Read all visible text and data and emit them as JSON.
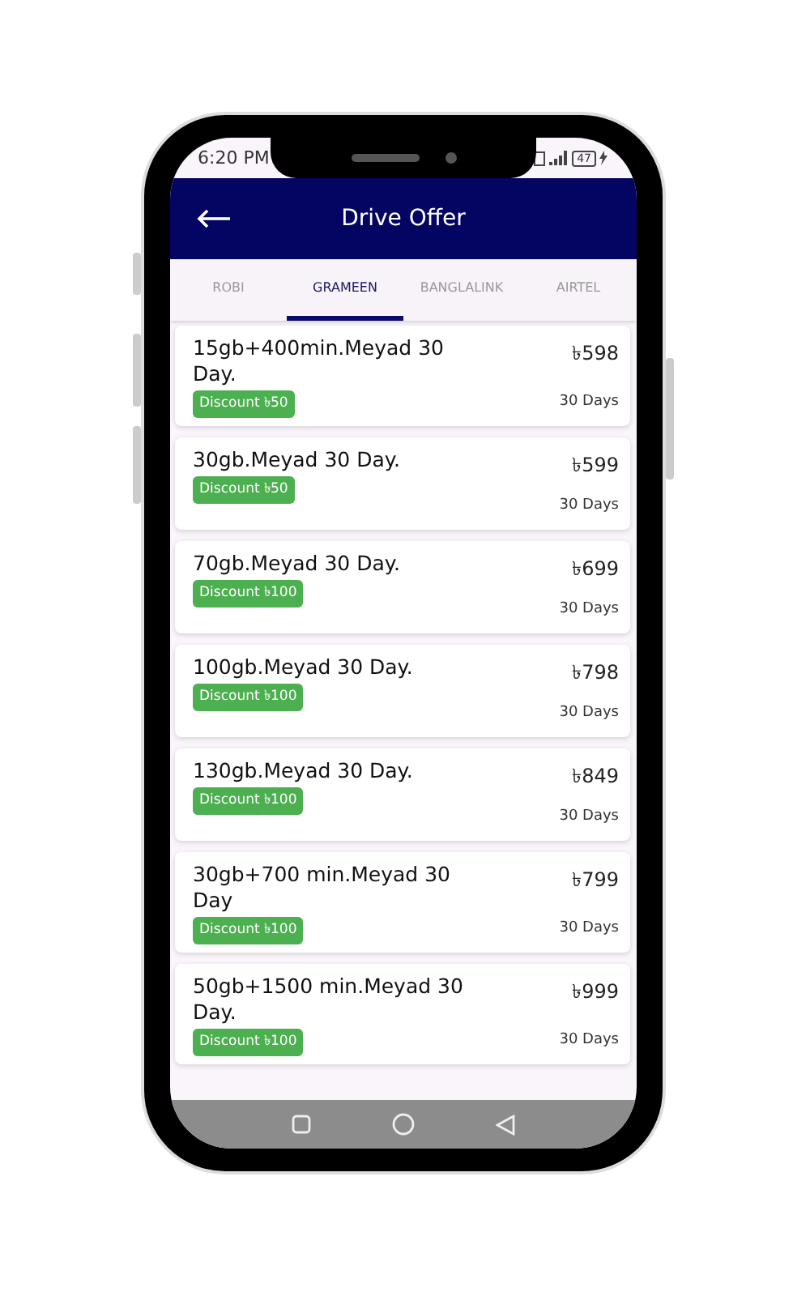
{
  "status_bar": {
    "time": "6:20 PM",
    "battery": "47"
  },
  "header": {
    "title": "Drive Offer"
  },
  "tabs": [
    {
      "label": "ROBI",
      "selected": false
    },
    {
      "label": "GRAMEEN",
      "selected": true
    },
    {
      "label": "BANGLALINK",
      "selected": false
    },
    {
      "label": "AIRTEL",
      "selected": false
    }
  ],
  "offers": [
    {
      "name": "15gb+400min.Meyad 30 Day.",
      "discount": "Discount ৳50",
      "price": "৳598",
      "validity": "30 Days"
    },
    {
      "name": "30gb.Meyad 30 Day.",
      "discount": "Discount ৳50",
      "price": "৳599",
      "validity": "30 Days"
    },
    {
      "name": "70gb.Meyad 30 Day.",
      "discount": "Discount ৳100",
      "price": "৳699",
      "validity": "30 Days"
    },
    {
      "name": "100gb.Meyad 30 Day.",
      "discount": "Discount ৳100",
      "price": "৳798",
      "validity": "30 Days"
    },
    {
      "name": "130gb.Meyad 30 Day.",
      "discount": "Discount ৳100",
      "price": "৳849",
      "validity": "30 Days"
    },
    {
      "name": "30gb+700 min.Meyad 30 Day",
      "discount": "Discount ৳100",
      "price": "৳799",
      "validity": "30 Days"
    },
    {
      "name": "50gb+1500 min.Meyad 30 Day.",
      "discount": "Discount ৳100",
      "price": "৳999",
      "validity": "30 Days"
    }
  ]
}
